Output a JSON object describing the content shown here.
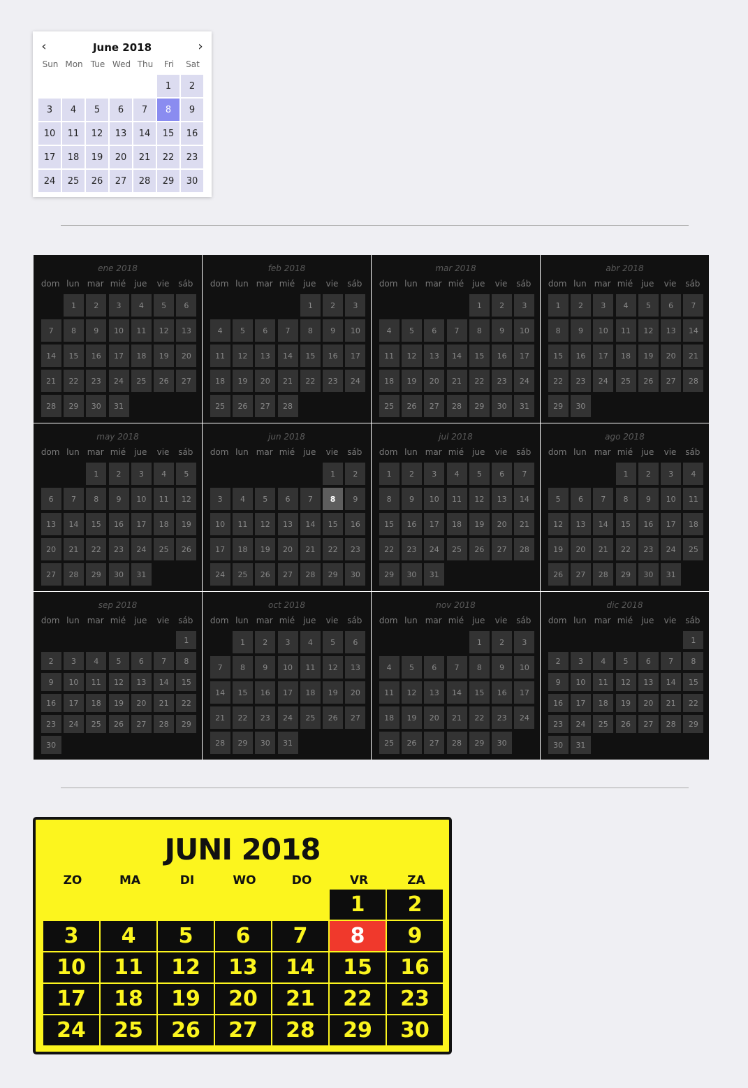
{
  "small_calendar": {
    "title": "June 2018",
    "prev_icon": "chevron-left-icon",
    "next_icon": "chevron-right-icon",
    "weekdays": [
      "Sun",
      "Mon",
      "Tue",
      "Wed",
      "Thu",
      "Fri",
      "Sat"
    ],
    "leading_blanks": 5,
    "days_in_month": 30,
    "selected_day": 8,
    "colors": {
      "day_bg": "#dcdcf0",
      "selected_bg": "#8a8cf0"
    }
  },
  "year_calendar": {
    "weekdays": [
      "dom",
      "lun",
      "mar",
      "mié",
      "jue",
      "vie",
      "sáb"
    ],
    "selected": {
      "month_index": 5,
      "day": 8
    },
    "months": [
      {
        "title": "ene 2018",
        "lead": 1,
        "days": 31
      },
      {
        "title": "feb 2018",
        "lead": 4,
        "days": 28
      },
      {
        "title": "mar 2018",
        "lead": 4,
        "days": 31
      },
      {
        "title": "abr 2018",
        "lead": 0,
        "days": 30
      },
      {
        "title": "may 2018",
        "lead": 2,
        "days": 31
      },
      {
        "title": "jun 2018",
        "lead": 5,
        "days": 30
      },
      {
        "title": "jul 2018",
        "lead": 0,
        "days": 31
      },
      {
        "title": "ago 2018",
        "lead": 3,
        "days": 31
      },
      {
        "title": "sep 2018",
        "lead": 6,
        "days": 30
      },
      {
        "title": "oct 2018",
        "lead": 1,
        "days": 31
      },
      {
        "title": "nov 2018",
        "lead": 4,
        "days": 30
      },
      {
        "title": "dic 2018",
        "lead": 6,
        "days": 31
      }
    ]
  },
  "big_calendar": {
    "title": "JUNI 2018",
    "weekdays": [
      "ZO",
      "MA",
      "DI",
      "WO",
      "DO",
      "VR",
      "ZA"
    ],
    "leading_blanks": 5,
    "days_in_month": 30,
    "selected_day": 8,
    "colors": {
      "background": "#fcf51e",
      "day_bg": "#0d0d0d",
      "selected_bg": "#f0392c"
    }
  }
}
